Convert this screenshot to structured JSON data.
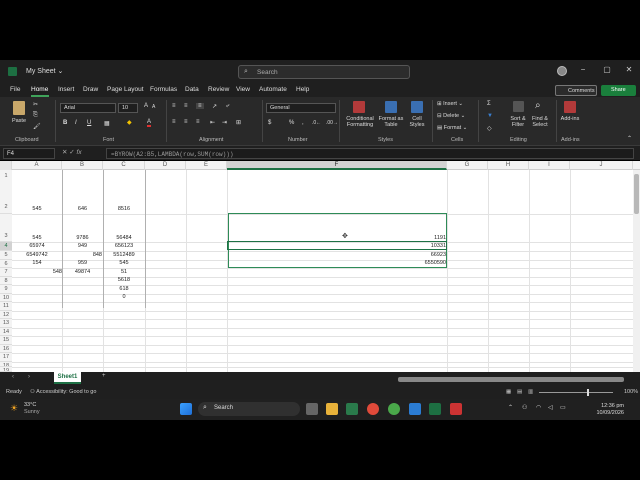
{
  "window": {
    "title": "My Sheet",
    "search_placeholder": "Search",
    "controls": [
      "−",
      "▢",
      "✕"
    ]
  },
  "menu": {
    "tabs": [
      "File",
      "Home",
      "Insert",
      "Draw",
      "Page Layout",
      "Formulas",
      "Data",
      "Review",
      "View",
      "Automate",
      "Help"
    ],
    "comments_label": "Comments",
    "share_label": "Share"
  },
  "ribbon": {
    "paste_label": "Paste",
    "font_name": "Arial",
    "font_size": "10",
    "number_format": "General",
    "conditional_formatting": "Conditional Formatting",
    "format_as_table": "Format as Table",
    "cell_styles": "Cell Styles",
    "insert_label": "Insert",
    "delete_label": "Delete",
    "format_label": "Format",
    "sort_filter": "Sort & Filter",
    "find_select": "Find & Select",
    "addins": "Add-ins",
    "groups": {
      "clipboard": "Clipboard",
      "font": "Font",
      "alignment": "Alignment",
      "number": "Number",
      "styles": "Styles",
      "cells": "Cells",
      "editing": "Editing",
      "addins": "Add-ins"
    }
  },
  "formula_bar": {
    "name_box": "F4",
    "fx": "fx",
    "formula": "=BYROW(A2:B5,LAMBDA(row,SUM(row)))"
  },
  "grid": {
    "columns": [
      "A",
      "B",
      "C",
      "D",
      "E",
      "F",
      "G",
      "H",
      "I",
      "J"
    ],
    "rows": [
      "1",
      "2",
      "3",
      "4",
      "5",
      "6",
      "7",
      "8",
      "9",
      "10",
      "11",
      "12",
      "13",
      "14",
      "15",
      "16",
      "17",
      "18",
      "19"
    ],
    "cells": {
      "A2": "545",
      "B2": "646",
      "C2": "8516",
      "A3": "545",
      "B3": "9786",
      "C3": "56484",
      "A4": "65974",
      "B4": "949",
      "C4": "656123",
      "A5": "6549742",
      "B5": "848",
      "C5": "5512489",
      "A6": "154",
      "B6": "959",
      "C6": "545",
      "A7": "548",
      "B7": "49874",
      "C7": "51",
      "C8": "5618",
      "C9": "618",
      "C10": "0",
      "F3": "1191",
      "F4": "10331",
      "F5": "66923",
      "F6": "6550590"
    }
  },
  "sheet_tab": "Sheet1",
  "status": {
    "ready": "Ready",
    "accessibility": "Accessibility: Good to go",
    "zoom": "100%"
  },
  "taskbar": {
    "weather_temp": "33°C",
    "weather_desc": "Sunny",
    "search_label": "Search",
    "time": "12:36 pm",
    "date": "10/09/2026"
  }
}
